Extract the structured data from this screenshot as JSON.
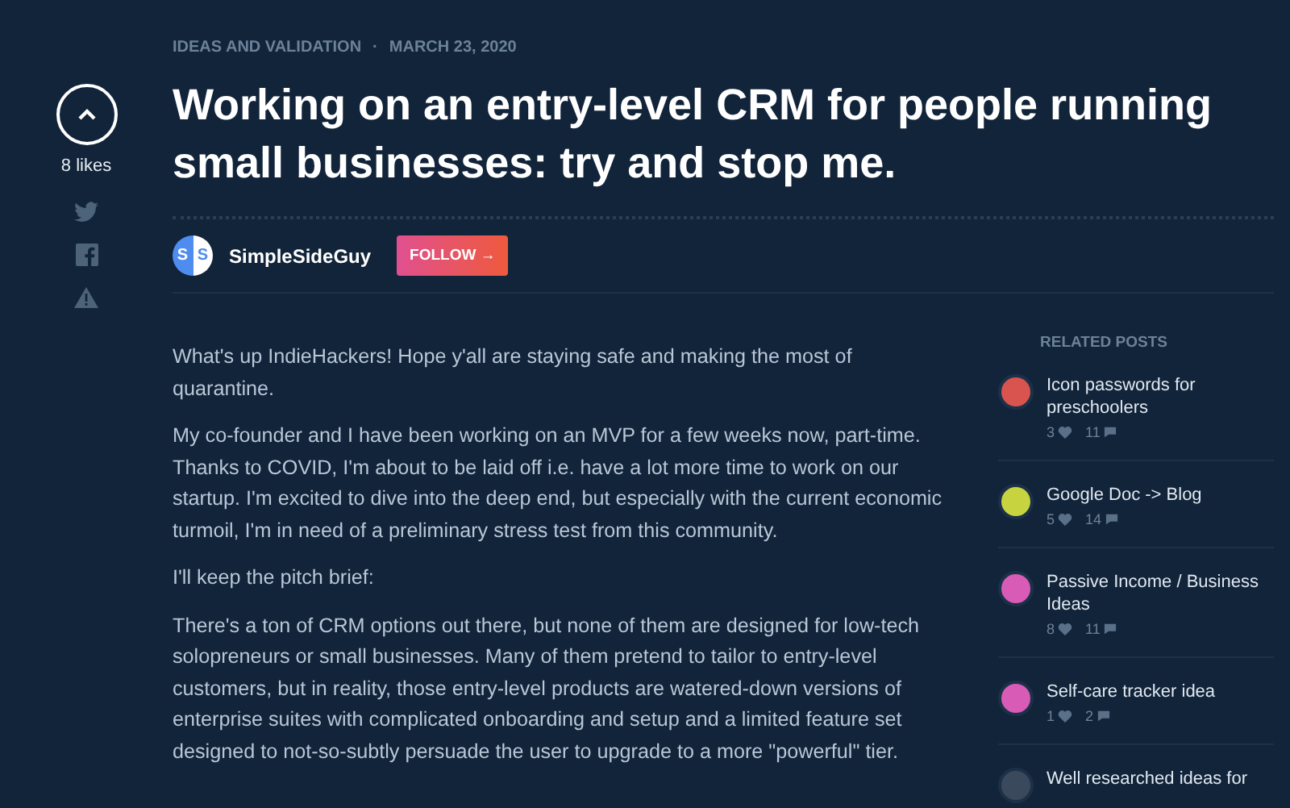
{
  "meta": {
    "category": "IDEAS AND VALIDATION",
    "separator": "·",
    "date": "MARCH 23, 2020"
  },
  "title": "Working on an entry-level CRM for people running small businesses: try and stop me.",
  "likes": {
    "count": "8 likes"
  },
  "author": {
    "initials": [
      "S",
      "S"
    ],
    "name": "SimpleSideGuy",
    "follow": "FOLLOW →"
  },
  "body": [
    "What's up IndieHackers! Hope y'all are staying safe and making the most of quarantine.",
    "My co-founder and I have been working on an MVP for a few weeks now, part-time. Thanks to COVID, I'm about to be laid off i.e. have a lot more time to work on our startup. I'm excited to dive into the deep end, but especially with the current economic turmoil, I'm in need of a preliminary stress test from this community.",
    "I'll keep the pitch brief:",
    "There's a ton of CRM options out there, but none of them are designed for low-tech solopreneurs or small businesses. Many of them pretend to tailor to entry-level customers, but in reality, those entry-level products are watered-down versions of enterprise suites with complicated onboarding and setup and a limited feature set designed to not-so-subtly persuade the user to upgrade to a more \"powerful\" tier."
  ],
  "related": {
    "heading": "RELATED POSTS",
    "posts": [
      {
        "title": "Icon passwords for preschoolers",
        "likes": "3",
        "comments": "11",
        "color": "#d9534f"
      },
      {
        "title": "Google Doc -> Blog",
        "likes": "5",
        "comments": "14",
        "color": "#c8d43f"
      },
      {
        "title": "Passive Income / Business Ideas",
        "likes": "8",
        "comments": "11",
        "color": "#d85bb5"
      },
      {
        "title": "Self-care tracker idea",
        "likes": "1",
        "comments": "2",
        "color": "#d85bb5"
      },
      {
        "title": "Well researched ideas for",
        "color": "#3a4a5c"
      }
    ]
  }
}
